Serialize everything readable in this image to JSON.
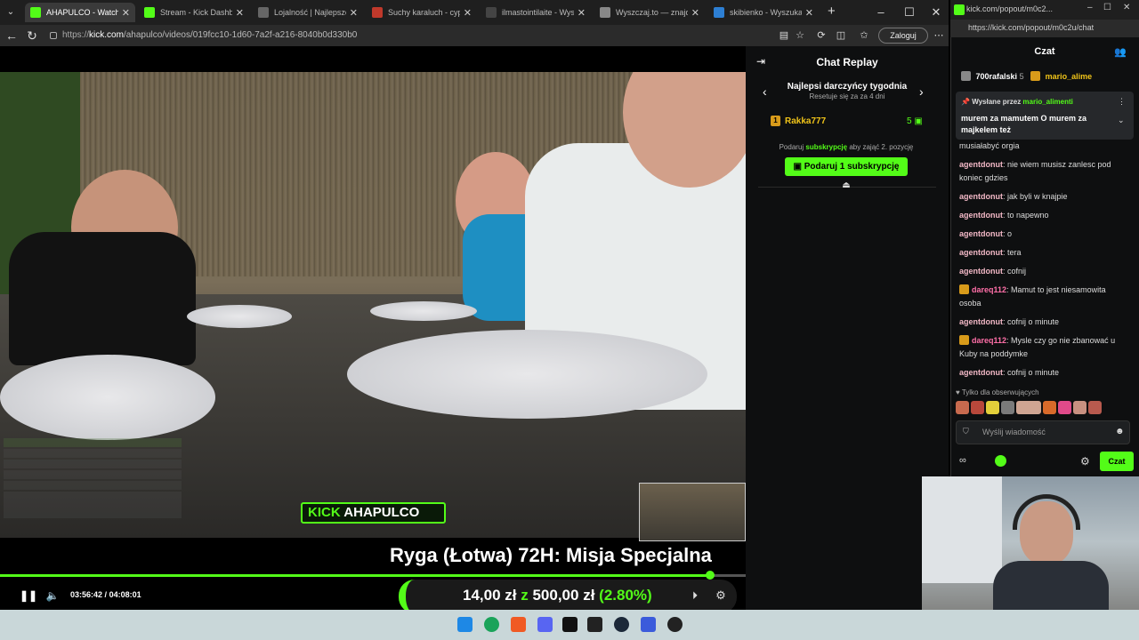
{
  "main_window": {
    "tabs": [
      {
        "title": "AHAPULCO - Watch",
        "active": true
      },
      {
        "title": "Stream - Kick Dashboard",
        "active": false
      },
      {
        "title": "Lojalność | Najlepsze op",
        "active": false
      },
      {
        "title": "Suchy karaluch - cypis -",
        "active": false
      },
      {
        "title": "ilmastointilaite - Wyszuk",
        "active": false
      },
      {
        "title": "Wyszczaj.to — znajdź na",
        "active": false
      },
      {
        "title": "skibienko - Wyszukaj",
        "active": false
      }
    ],
    "url_prefix": "https://",
    "url_host": "kick.com",
    "url_path": "/ahapulco/videos/019fcc10-1d60-7a2f-a216-8040b0d330b0",
    "login_label": "Zaloguj"
  },
  "video": {
    "channel_badge": "AHAPULCO",
    "channel_badge_prefix": "KICK",
    "title": "Ryga (Łotwa) 72H: Misja Specjalna",
    "current_time": "03:56:42",
    "duration": "04:08:01",
    "time_separator": "/",
    "progress": 0.952,
    "donation_current": "14,00 zł",
    "donation_connector": "z",
    "donation_goal": "500,00 zł",
    "donation_percent": "(2.80%)"
  },
  "chat_replay": {
    "title": "Chat Replay",
    "donors_title": "Najlepsi darczyńcy tygodnia",
    "donors_reset": "Resetuje się za za 4 dni",
    "top_donor": {
      "rank": "1",
      "name": "Rakka777",
      "count": "5"
    },
    "gift_info_prefix": "Podaruj",
    "gift_info_highlight": "subskrypcję",
    "gift_info_suffix": "aby zająć 2. pozycję",
    "gift_button": "Podaruj 1 subskrypcję"
  },
  "chat_window": {
    "tab_title": "kick.com/popout/m0c2...",
    "url": "https://kick.com/popout/m0c2u/chat",
    "header": "Czat",
    "top_gifters": [
      {
        "name": "700rafalski",
        "count": "5"
      },
      {
        "name": "mario_alime",
        "count": ""
      }
    ],
    "pinned_by_label": "Wysłane przez",
    "pinned_by_user": "mario_alimenti",
    "pinned_message": "murem za mamutem O murem za majkelem też",
    "messages": [
      {
        "user": "",
        "text": "musiałabyć orgia",
        "badge": false
      },
      {
        "user": "agentdonut",
        "text": "nie wiem musisz zanlesc pod koniec gdzies",
        "badge": false
      },
      {
        "user": "agentdonut",
        "text": "jak byli w knajpie",
        "badge": false
      },
      {
        "user": "agentdonut",
        "text": "to napewno",
        "badge": false
      },
      {
        "user": "agentdonut",
        "text": "o",
        "badge": false
      },
      {
        "user": "agentdonut",
        "text": "tera",
        "badge": false
      },
      {
        "user": "agentdonut",
        "text": "cofnij",
        "badge": false
      },
      {
        "user": "dareq112",
        "text": "Mamut to jest niesamowita osoba",
        "badge": true
      },
      {
        "user": "agentdonut",
        "text": "cofnij o minute",
        "badge": false
      },
      {
        "user": "dareq112",
        "text": "Mysle czy go nie zbanować u Kuby na poddymke",
        "badge": true
      },
      {
        "user": "agentdonut",
        "text": "cofnij o minute",
        "badge": false
      }
    ],
    "followers_only": "Tylko dla obserwujących",
    "input_placeholder": "Wyślij wiadomość",
    "send_label": "Czat"
  },
  "colors": {
    "kick_green": "#53fc18",
    "user_agentdonut": "#f2b8c6",
    "user_dareq112": "#ff6fa8",
    "gold": "#f0c419"
  }
}
